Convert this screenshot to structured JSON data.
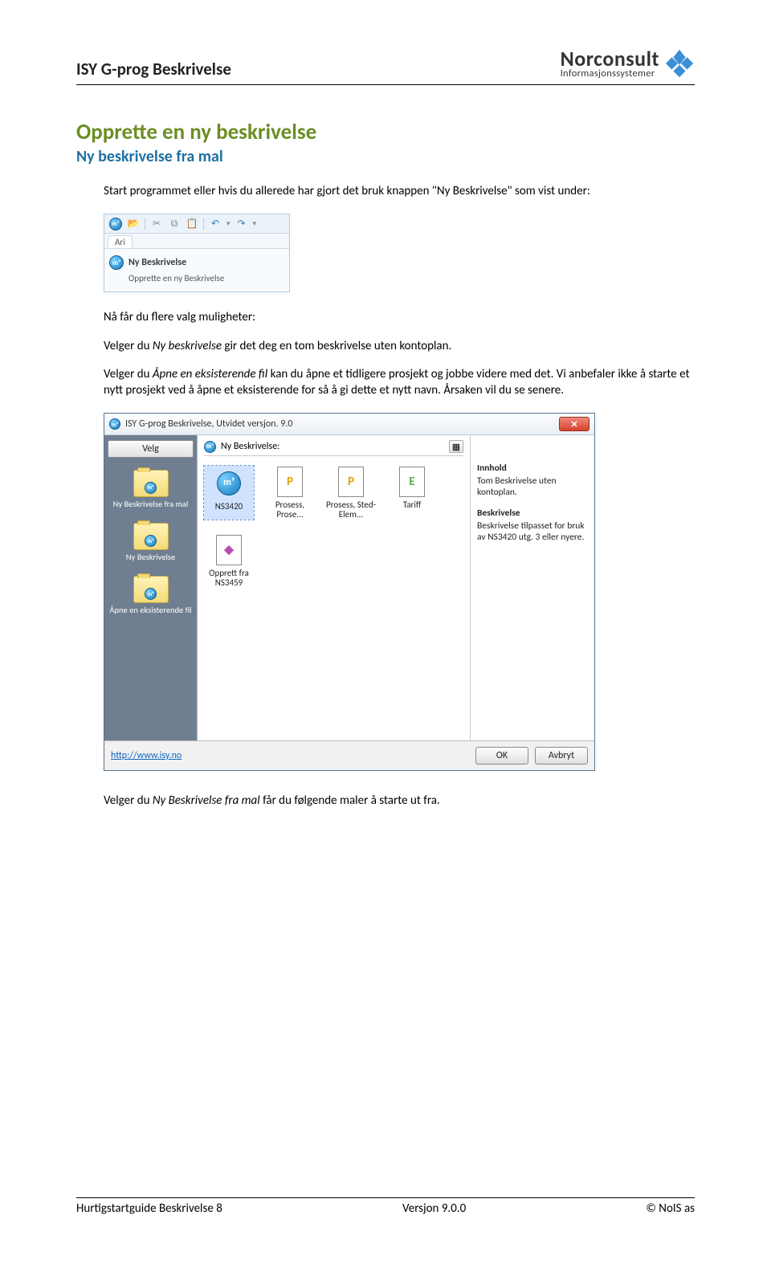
{
  "header": {
    "title": "ISY G-prog Beskrivelse",
    "logo_name": "Norconsult",
    "logo_sub": "Informasjonssystemer"
  },
  "section_title": "Opprette en ny beskrivelse",
  "sub_title": "Ny beskrivelse fra mal",
  "p1": "Start programmet eller hvis du allerede har gjort det bruk knappen \"Ny Beskrivelse\" som vist under:",
  "toolbar": {
    "tab_label": "Ari",
    "card_title": "Ny Beskrivelse",
    "card_desc": "Opprette en ny Beskrivelse",
    "mb_text": "m³"
  },
  "p2_pre": "Nå får du flere valg muligheter:",
  "p3a": "Velger du ",
  "p3b": "Ny beskrivelse",
  "p3c": " gir det deg en tom beskrivelse uten kontoplan.",
  "p4a": "Velger du ",
  "p4b": "Åpne en eksisterende fil",
  "p4c": " kan du åpne et tidligere prosjekt og jobbe videre med det. Vi anbefaler ikke å starte et nytt prosjekt ved å åpne et eksisterende for så å gi dette et nytt navn. Årsaken vil du se senere.",
  "dialog": {
    "title": "ISY G-prog Beskrivelse, Utvidet versjon. 9.0",
    "velg": "Velg",
    "header_label": "Ny Beskrivelse:",
    "sidebar": [
      "Ny Beskrivelse fra mal",
      "Ny Beskrivelse",
      "Åpne en eksisterende fil"
    ],
    "items": [
      {
        "label": "NS3420",
        "glyph": "m³",
        "style": "mb",
        "selected": true
      },
      {
        "label": "Prosess, Prose...",
        "glyph": "P",
        "style": "p"
      },
      {
        "label": "Prosess, Sted-Elem...",
        "glyph": "P",
        "style": "p"
      },
      {
        "label": "Tariff",
        "glyph": "E",
        "style": "e"
      },
      {
        "label": "Opprett fra NS3459",
        "glyph": "◆",
        "style": "any"
      }
    ],
    "right": {
      "innhold_t": "Innhold",
      "innhold": "Tom Beskrivelse uten kontoplan.",
      "besk_t": "Beskrivelse",
      "besk": "Beskrivelse tilpasset for bruk av NS3420 utg. 3 eller nyere."
    },
    "link": "http://www.isy.no",
    "ok": "OK",
    "cancel": "Avbryt"
  },
  "p5a": "Velger du ",
  "p5b": "Ny Beskrivelse fra mal",
  "p5c": " får du følgende maler å starte ut fra.",
  "footer": {
    "left": "Hurtigstartguide Beskrivelse 8",
    "center": "Versjon 9.0.0",
    "right": "© NoIS as"
  }
}
